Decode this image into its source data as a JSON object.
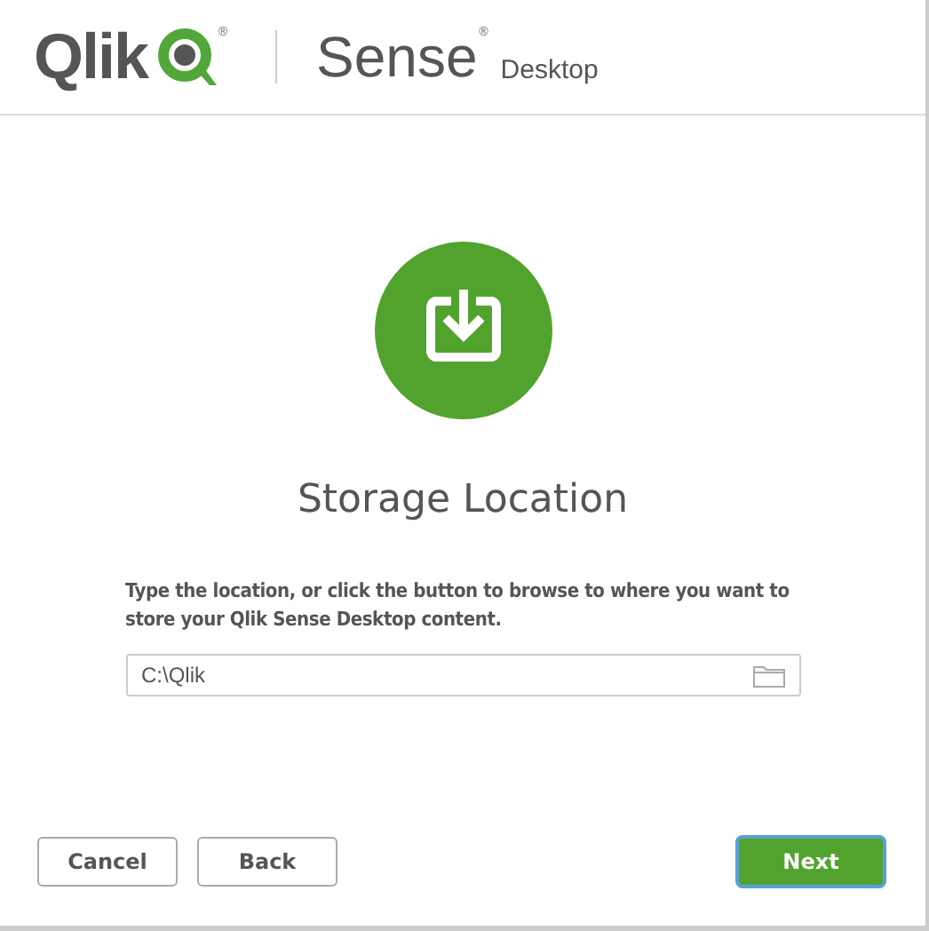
{
  "header": {
    "brand": "Qlik",
    "brand_mark": "®",
    "product": "Sense",
    "product_mark": "®",
    "edition": "Desktop"
  },
  "title": "Storage Location",
  "description": "Type the location, or click the button to browse to where you want to store your Qlik Sense Desktop content.",
  "location_field": {
    "value": "C:\\Qlik"
  },
  "buttons": [
    {
      "label": "Cancel",
      "kind": "secondary",
      "focused": false
    },
    {
      "label": "Back",
      "kind": "secondary",
      "focused": false
    },
    {
      "label": "Next",
      "kind": "primary",
      "focused": true
    }
  ]
}
